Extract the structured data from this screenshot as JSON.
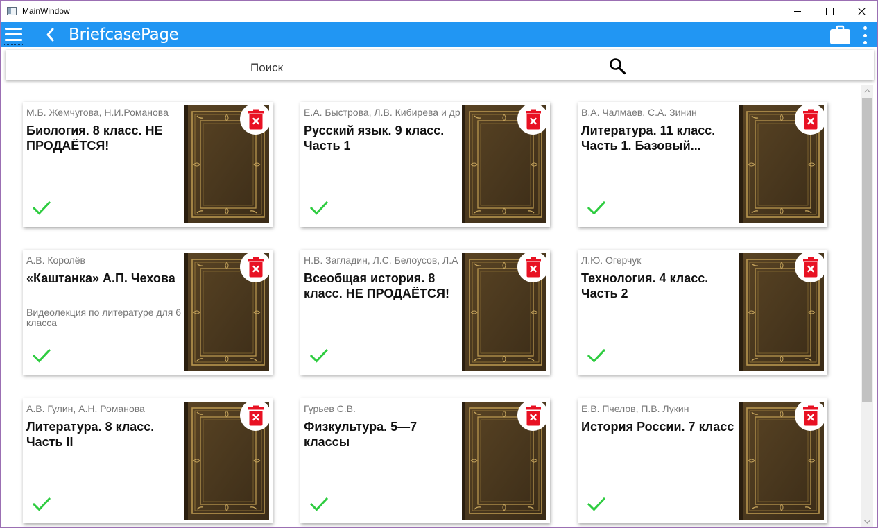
{
  "window": {
    "title": "MainWindow"
  },
  "appbar": {
    "title": "BriefcasePage",
    "color": "#2196f3"
  },
  "search": {
    "label": "Поиск",
    "value": "",
    "placeholder": ""
  },
  "colors": {
    "delete": "#e81123",
    "check": "#2ecc40"
  },
  "books": [
    {
      "authors": "М.Б. Жемчугова, Н.И.Романова",
      "title": "Биология. 8 класс. НЕ ПРОДАЁТСЯ!",
      "subtitle": "",
      "downloaded": true
    },
    {
      "authors": "Е.А. Быстрова, Л.В. Кибирева и др",
      "title": "Русский язык. 9 класс. Часть 1",
      "subtitle": "",
      "downloaded": true
    },
    {
      "authors": "В.А. Чалмаев, С.А. Зинин",
      "title": "Литература. 11 класс. Часть 1. Базовый...",
      "subtitle": "",
      "downloaded": true
    },
    {
      "authors": "А.В. Королёв",
      "title": "«Каштанка» А.П. Чехова",
      "subtitle": "Видеолекция по литературе для 6 класса",
      "downloaded": true
    },
    {
      "authors": "Н.В. Загладин, Л.С. Белоусов, Л.А",
      "title": "Всеобщая история. 8 класс. НЕ ПРОДАЁТСЯ!",
      "subtitle": "",
      "downloaded": true
    },
    {
      "authors": "Л.Ю. Огерчук",
      "title": "Технология. 4 класс. Часть 2",
      "subtitle": "",
      "downloaded": true
    },
    {
      "authors": "А.В. Гулин, А.Н. Романова",
      "title": "Литература. 8 класс. Часть II",
      "subtitle": "",
      "downloaded": true
    },
    {
      "authors": "Гурьев С.В.",
      "title": "Физкультура. 5—7 классы",
      "subtitle": "",
      "downloaded": true
    },
    {
      "authors": "Е.В. Пчелов, П.В. Лукин",
      "title": "История России. 7 класс",
      "subtitle": "",
      "downloaded": true
    }
  ]
}
